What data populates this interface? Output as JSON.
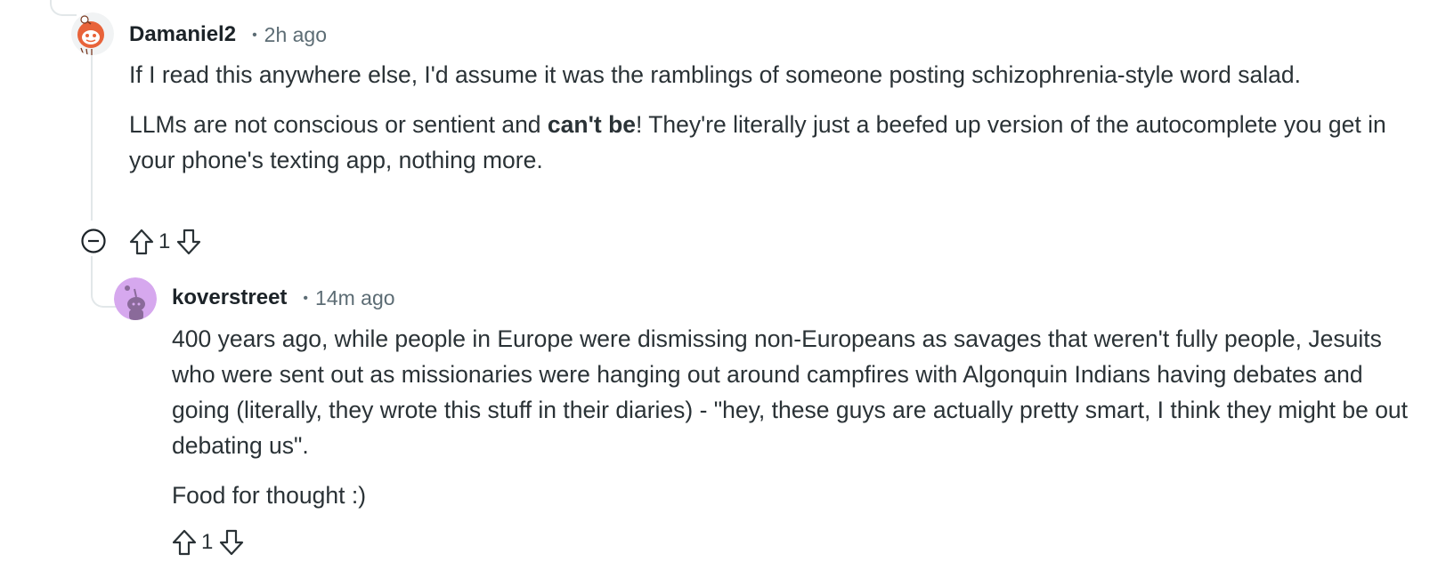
{
  "comments": [
    {
      "author": "Damaniel2",
      "separator": "•",
      "time": "2h ago",
      "paragraphs": [
        {
          "text": "If I read this anywhere else, I'd assume it was the ramblings of someone posting schizophrenia-style word salad."
        },
        {
          "before": "LLMs are not conscious or sentient and ",
          "bold": "can't be",
          "after": "! They're literally just a beefed up version of the autocomplete you get in your phone's texting app, nothing more."
        }
      ],
      "score": "1",
      "avatar_icon": "reddit-snoo-orange-avatar-icon"
    },
    {
      "author": "koverstreet",
      "separator": "•",
      "time": "14m ago",
      "paragraphs": [
        {
          "text": "400 years ago, while people in Europe were dismissing non-Europeans as savages that weren't fully people, Jesuits who were sent out as missionaries were hanging out around campfires with Algonquin Indians having debates and going (literally, they wrote this stuff in their diaries) - \"hey, these guys are actually pretty smart, I think they might be out debating us\"."
        },
        {
          "text": "Food for thought :)"
        }
      ],
      "score": "1",
      "avatar_icon": "reddit-snoo-purple-avatar-icon"
    }
  ],
  "icons": {
    "upvote": "arrow-up-outline-icon",
    "downvote": "arrow-down-outline-icon",
    "collapse": "minus-circle-icon"
  },
  "colors": {
    "text": "#2a3236",
    "meta": "#5c6c74",
    "thread_line": "#e2e7e9",
    "avatar1_bg": "#e8633a",
    "avatar2_bg": "#d6a8ee"
  }
}
